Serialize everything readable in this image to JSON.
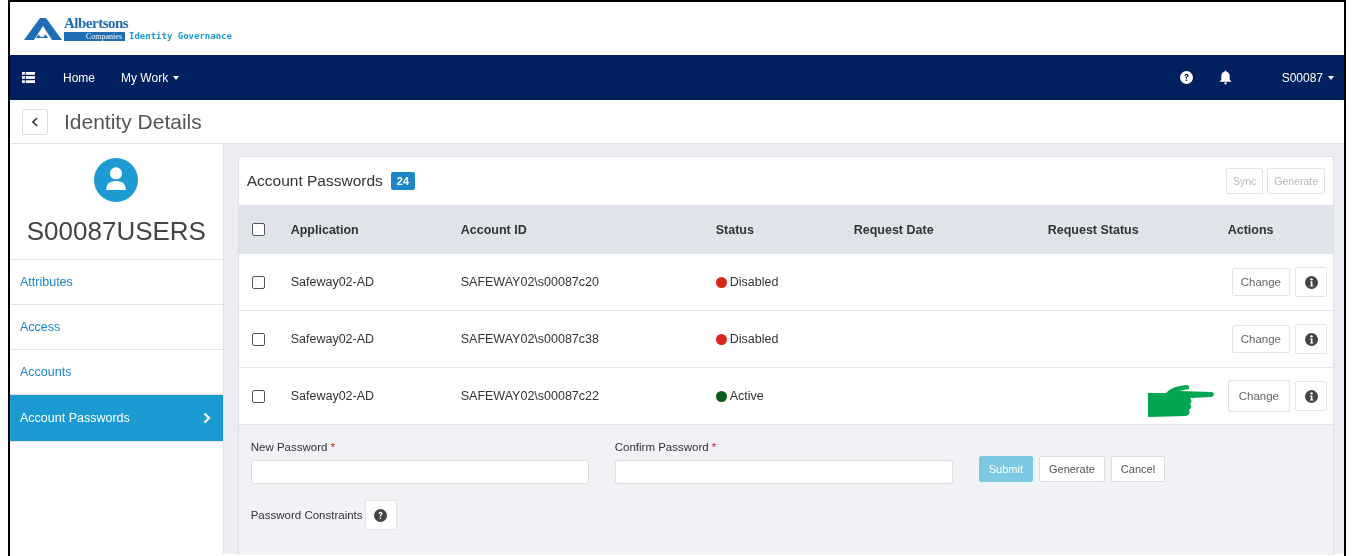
{
  "brand": {
    "name": "Albertsons",
    "sub": "Companies",
    "product": "Identity Governance"
  },
  "nav": {
    "items": [
      {
        "label": "Home",
        "dropdown": false
      },
      {
        "label": "My Work",
        "dropdown": true
      }
    ],
    "user": "S00087"
  },
  "page_title": "Identity Details",
  "identity": {
    "name": "S00087USERS"
  },
  "sidebar": {
    "items": [
      {
        "label": "Attributes",
        "selected": false
      },
      {
        "label": "Access",
        "selected": false
      },
      {
        "label": "Accounts",
        "selected": false
      },
      {
        "label": "Account Passwords",
        "selected": true
      }
    ]
  },
  "panel": {
    "title": "Account Passwords",
    "count": "24",
    "buttons": [
      {
        "label": "Sync",
        "disabled": true
      },
      {
        "label": "Generate",
        "disabled": true
      }
    ]
  },
  "table": {
    "all_checked": false,
    "columns": [
      "Application",
      "Account ID",
      "Status",
      "Request Date",
      "Request Status",
      "Actions"
    ],
    "rows": [
      {
        "checked": false,
        "application": "Safeway02-AD",
        "account_id": "SAFEWAY02\\s00087c20",
        "status": "Disabled",
        "color": "#d9261c",
        "action": "Change",
        "expanded": false
      },
      {
        "checked": false,
        "application": "Safeway02-AD",
        "account_id": "SAFEWAY02\\s00087c38",
        "status": "Disabled",
        "color": "#d9261c",
        "action": "Change",
        "expanded": false
      },
      {
        "checked": false,
        "application": "Safeway02-AD",
        "account_id": "SAFEWAY02\\s00087c22",
        "status": "Active",
        "color": "#0b5a1e",
        "action": "Change",
        "expanded": true
      }
    ]
  },
  "form": {
    "required_mark": "*",
    "fields": [
      {
        "label": "New Password",
        "required": true
      },
      {
        "label": "Confirm Password",
        "required": true
      }
    ],
    "buttons": [
      {
        "label": "Submit",
        "primary": true
      },
      {
        "label": "Generate",
        "primary": false
      },
      {
        "label": "Cancel",
        "primary": false
      }
    ],
    "constraints_label": "Password Constraints"
  }
}
